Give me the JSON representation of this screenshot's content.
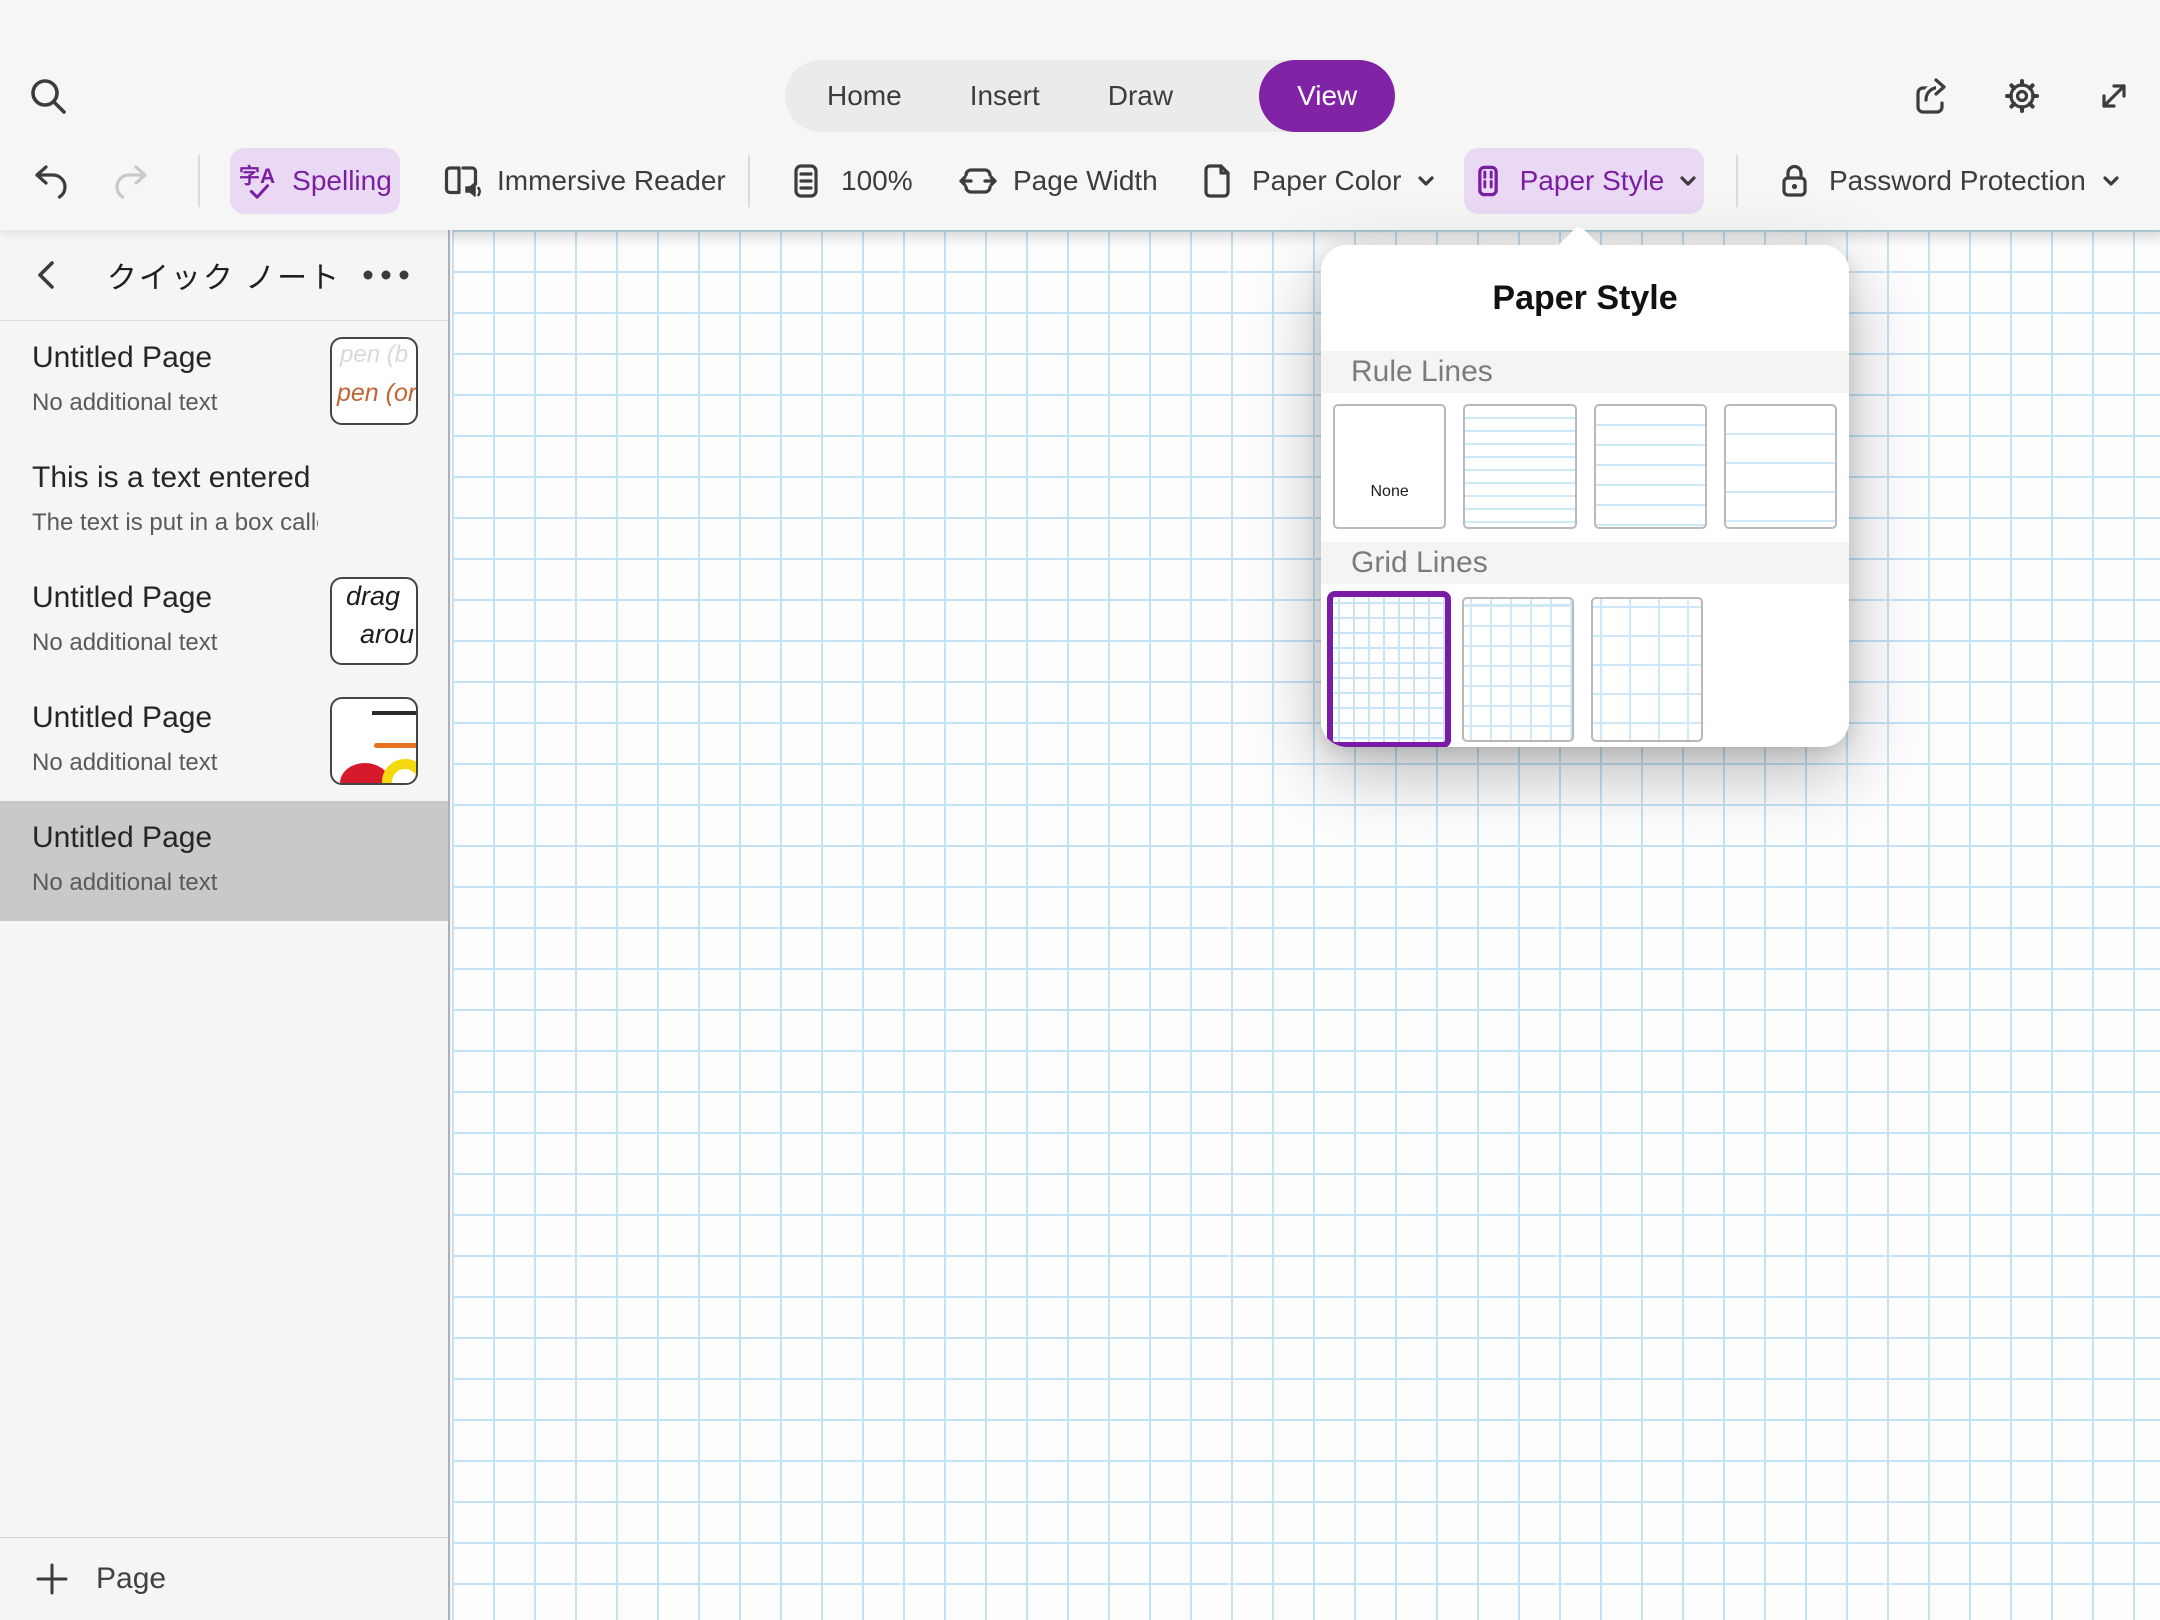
{
  "topbar": {
    "tabs": [
      {
        "label": "Home",
        "active": false
      },
      {
        "label": "Insert",
        "active": false
      },
      {
        "label": "Draw",
        "active": false
      },
      {
        "label": "View",
        "active": true
      }
    ]
  },
  "toolbar": {
    "spelling_label": "Spelling",
    "immersive_reader_label": "Immersive Reader",
    "zoom_label": "100%",
    "page_width_label": "Page Width",
    "paper_color_label": "Paper Color",
    "paper_style_label": "Paper Style",
    "password_label": "Password Protection"
  },
  "sidebar": {
    "title": "クイック ノート",
    "pages": [
      {
        "title": "Untitled Page",
        "subtitle": "No additional text",
        "thumb_line1": "pen (b",
        "thumb_line2": "pen (ora",
        "selected": false
      },
      {
        "title": "This is a text entered in...",
        "subtitle": "The text is put in a box called...",
        "selected": false
      },
      {
        "title": "Untitled Page",
        "subtitle": "No additional text",
        "thumb_line1": "drag",
        "thumb_line2": "arou",
        "selected": false
      },
      {
        "title": "Untitled Page",
        "subtitle": "No additional text",
        "selected": false
      },
      {
        "title": "Untitled Page",
        "subtitle": "No additional text",
        "selected": true
      }
    ],
    "add_page_label": "Page"
  },
  "popup": {
    "title": "Paper Style",
    "rule_section_label": "Rule Lines",
    "grid_section_label": "Grid Lines",
    "none_label": "None",
    "rule_options": [
      "none",
      "narrow",
      "college",
      "wide"
    ],
    "grid_options": [
      "small-grid",
      "medium-grid",
      "large-grid"
    ],
    "selected_option": "small-grid"
  },
  "colors": {
    "accent": "#8023a5",
    "accent_soft": "#ead9f5",
    "accent_text": "#7b1fa2",
    "grid_blue": "#c3e2f4",
    "selected_item_bg": "#c9c8ca"
  }
}
